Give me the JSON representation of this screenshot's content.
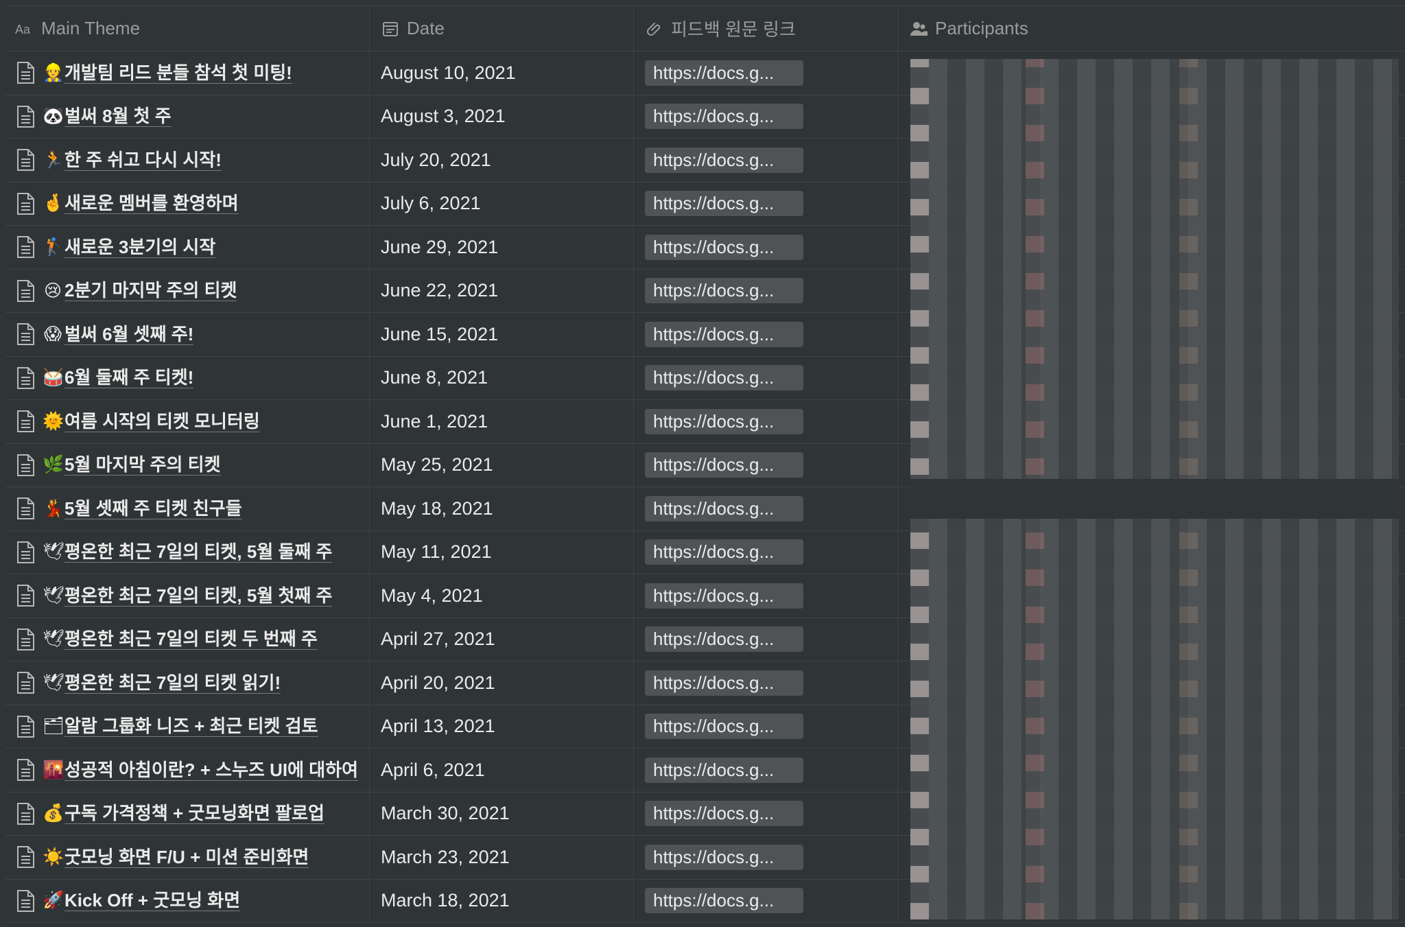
{
  "headers": {
    "theme": {
      "label": "Main Theme",
      "icon": "text-property-icon"
    },
    "date": {
      "label": "Date",
      "icon": "calendar-icon"
    },
    "link": {
      "label": "피드백 원문 링크",
      "icon": "paperclip-icon"
    },
    "participants": {
      "label": "Participants",
      "icon": "people-icon"
    }
  },
  "rows": [
    {
      "emoji": "👷",
      "title": "개발팀 리드 분들 참석 첫 미팅!",
      "date": "August 10, 2021",
      "link": "https://docs.g..."
    },
    {
      "emoji": "🐼",
      "title": "벌써 8월 첫 주",
      "date": "August 3, 2021",
      "link": "https://docs.g..."
    },
    {
      "emoji": "🏃",
      "title": "한 주 쉬고 다시 시작!",
      "date": "July 20, 2021",
      "link": "https://docs.g..."
    },
    {
      "emoji": "🤞",
      "title": "새로운 멤버를 환영하며",
      "date": "July 6, 2021",
      "link": "https://docs.g..."
    },
    {
      "emoji": "🏌",
      "title": "새로운 3분기의 시작",
      "date": "June 29, 2021",
      "link": "https://docs.g..."
    },
    {
      "emoji": "😢",
      "title": "2분기 마지막 주의 티켓",
      "date": "June 22, 2021",
      "link": "https://docs.g..."
    },
    {
      "emoji": "😱",
      "title": "벌써 6월 셋째 주!",
      "date": "June 15, 2021",
      "link": "https://docs.g..."
    },
    {
      "emoji": "🥁",
      "title": "6월 둘째 주 티켓!",
      "date": "June 8, 2021",
      "link": "https://docs.g..."
    },
    {
      "emoji": "🌞",
      "title": "여름 시작의 티켓 모니터링",
      "date": "June 1, 2021",
      "link": "https://docs.g..."
    },
    {
      "emoji": "🌿",
      "title": "5월 마지막 주의 티켓",
      "date": "May 25, 2021",
      "link": "https://docs.g..."
    },
    {
      "emoji": "💃",
      "title": "5월 셋째 주 티켓 친구들",
      "date": "May 18, 2021",
      "link": "https://docs.g..."
    },
    {
      "emoji": "🕊",
      "title": "평온한 최근 7일의 티켓, 5월 둘째 주",
      "date": "May 11, 2021",
      "link": "https://docs.g..."
    },
    {
      "emoji": "🕊",
      "title": "평온한 최근 7일의 티켓, 5월 첫째 주",
      "date": "May 4, 2021",
      "link": "https://docs.g..."
    },
    {
      "emoji": "🕊",
      "title": "평온한 최근 7일의 티켓 두 번째 주",
      "date": "April 27, 2021",
      "link": "https://docs.g..."
    },
    {
      "emoji": "🕊",
      "title": "평온한 최근 7일의 티켓 읽기!",
      "date": "April 20, 2021",
      "link": "https://docs.g..."
    },
    {
      "emoji": "🗂",
      "title": "알람 그룹화 니즈 + 최근 티켓 검토",
      "date": "April 13, 2021",
      "link": "https://docs.g..."
    },
    {
      "emoji": "🌇",
      "title": "성공적 아침이란? + 스누즈 UI에 대하여",
      "date": "April 6, 2021",
      "link": "https://docs.g..."
    },
    {
      "emoji": "💰",
      "title": "구독 가격정책 + 굿모닝화면 팔로업",
      "date": "March 30, 2021",
      "link": "https://docs.g..."
    },
    {
      "emoji": "☀️",
      "title": "굿모닝 화면 F/U + 미션 준비화면",
      "date": "March 23, 2021",
      "link": "https://docs.g..."
    },
    {
      "emoji": "🚀",
      "title": "Kick Off + 굿모닝 화면",
      "date": "March 18, 2021",
      "link": "https://docs.g..."
    }
  ],
  "colors": {
    "background": "#2f3437",
    "border": "#3f4447",
    "header_text": "#9b9c9a",
    "cell_text": "#ebebea",
    "link_pill": "#4f5356"
  }
}
